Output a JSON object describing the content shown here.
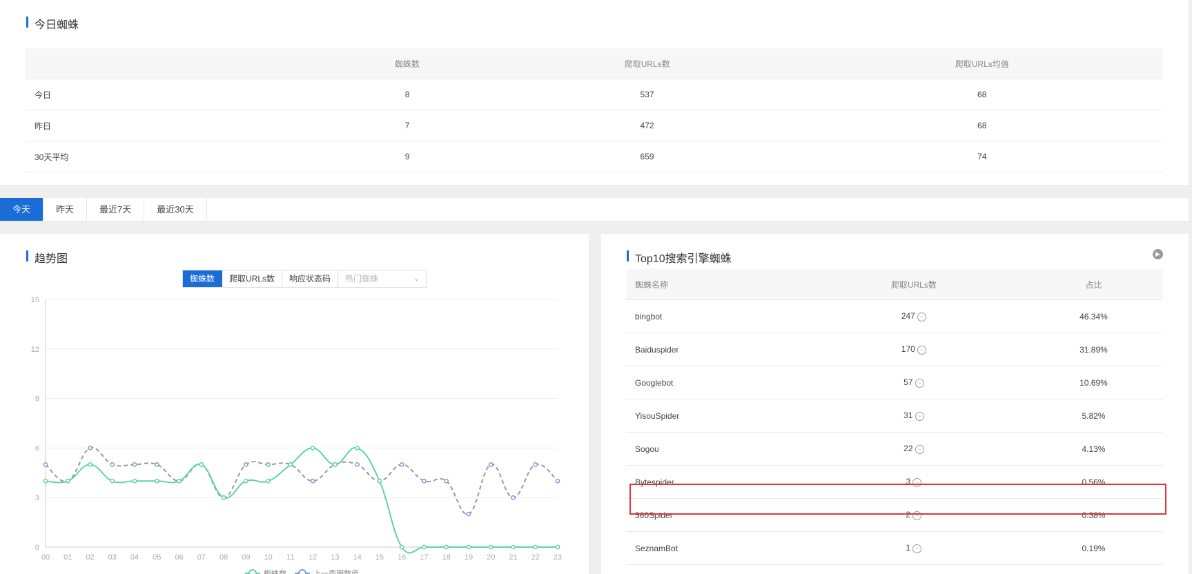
{
  "today_spiders": {
    "title": "今日蜘蛛",
    "headers": [
      "",
      "蜘蛛数",
      "爬取URLs数",
      "爬取URLs均值"
    ],
    "rows": [
      [
        "今日",
        "8",
        "537",
        "68"
      ],
      [
        "昨日",
        "7",
        "472",
        "68"
      ],
      [
        "30天平均",
        "9",
        "659",
        "74"
      ]
    ]
  },
  "tabs": [
    "今天",
    "昨天",
    "最近7天",
    "最近30天"
  ],
  "trend": {
    "title": "趋势图",
    "subtabs": [
      "蜘蛛数",
      "爬取URLs数",
      "响应状态码"
    ],
    "select_placeholder": "热门蜘蛛"
  },
  "top10": {
    "title": "Top10搜索引擎蜘蛛",
    "headers": [
      "蜘蛛名称",
      "爬取URLs数",
      "占比"
    ],
    "rows": [
      [
        "bingbot",
        "247",
        "46.34%"
      ],
      [
        "Baiduspider",
        "170",
        "31.89%"
      ],
      [
        "Googlebot",
        "57",
        "10.69%"
      ],
      [
        "YisouSpider",
        "31",
        "5.82%"
      ],
      [
        "Sogou",
        "22",
        "4.13%"
      ],
      [
        "Bytespider",
        "3",
        "0.56%"
      ],
      [
        "360Spider",
        "2",
        "0.38%"
      ],
      [
        "SeznamBot",
        "1",
        "0.19%"
      ]
    ],
    "highlighted_row": "360Spider"
  },
  "chart_data": {
    "type": "line",
    "x": [
      "00",
      "01",
      "02",
      "03",
      "04",
      "05",
      "06",
      "07",
      "08",
      "09",
      "10",
      "11",
      "12",
      "13",
      "14",
      "15",
      "16",
      "17",
      "18",
      "19",
      "20",
      "21",
      "22",
      "23"
    ],
    "yticks": [
      "0",
      "3",
      "6",
      "9",
      "12",
      "15"
    ],
    "ylim": [
      0,
      15
    ],
    "series": [
      {
        "name": "蜘蛛数",
        "color": "#5fd3a6",
        "dashed": false,
        "values": [
          4,
          4,
          5,
          4,
          4,
          4,
          4,
          5,
          3,
          4,
          4,
          5,
          6,
          5,
          6,
          4,
          0,
          0,
          0,
          0,
          0,
          0,
          0,
          0
        ]
      },
      {
        "name": "上一周期数值",
        "color": "#7d98d6",
        "line_color": "#9a9a9a",
        "dashed": true,
        "values": [
          5,
          4,
          6,
          5,
          5,
          5,
          4,
          5,
          3,
          5,
          5,
          5,
          4,
          5,
          5,
          4,
          5,
          4,
          4,
          2,
          5,
          3,
          5,
          4
        ]
      }
    ],
    "grid": true,
    "legend": "bottom"
  }
}
